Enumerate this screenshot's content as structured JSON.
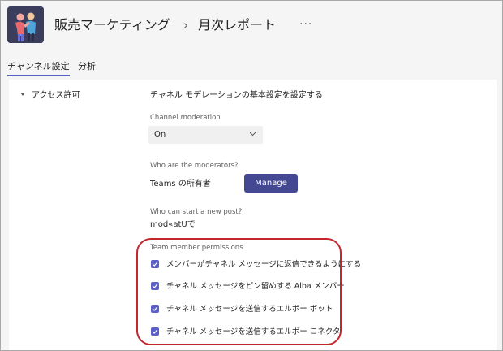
{
  "header": {
    "team_name": "販売マーケティング",
    "breadcrumb_separator": "›",
    "channel_name": "月次レポート",
    "more_label": "···"
  },
  "tabs": [
    {
      "label": "チャンネル設定",
      "active": true
    },
    {
      "label": "分析",
      "active": false
    }
  ],
  "panel": {
    "section_label": "アクセス許可",
    "section_title": "チャネル モデレーションの基本設定を設定する",
    "moderation": {
      "label": "Channel moderation",
      "value": "On"
    },
    "moderators": {
      "label": "Who are the moderators?",
      "value": "Teams の所有者",
      "button_label": "Manage"
    },
    "new_post": {
      "label": "Who can start a new post?",
      "value": "mod«atUで"
    },
    "permissions": {
      "label": "Team member permissions",
      "items": [
        {
          "label": "メンバーがチャネル メッセージに返信できるようにする",
          "checked": true
        },
        {
          "label": "チャネル メッセージをピン留めする Alba メンバー",
          "checked": true
        },
        {
          "label": "チャネル メッセージを送信するエルボー ボット",
          "checked": true
        },
        {
          "label": "チャネル メッセージを送信するエルボー コネクタ",
          "checked": true
        }
      ]
    }
  },
  "colors": {
    "accent": "#5b5fc7",
    "button": "#444791",
    "highlight": "#c4262e",
    "avatar_bg": "#3b3d5c"
  },
  "icons": {
    "team_avatar": "team-people-icon",
    "dropdown": "chevron-down-icon",
    "checkbox": "checkmark-icon",
    "section_toggle": "caret-down-icon"
  }
}
